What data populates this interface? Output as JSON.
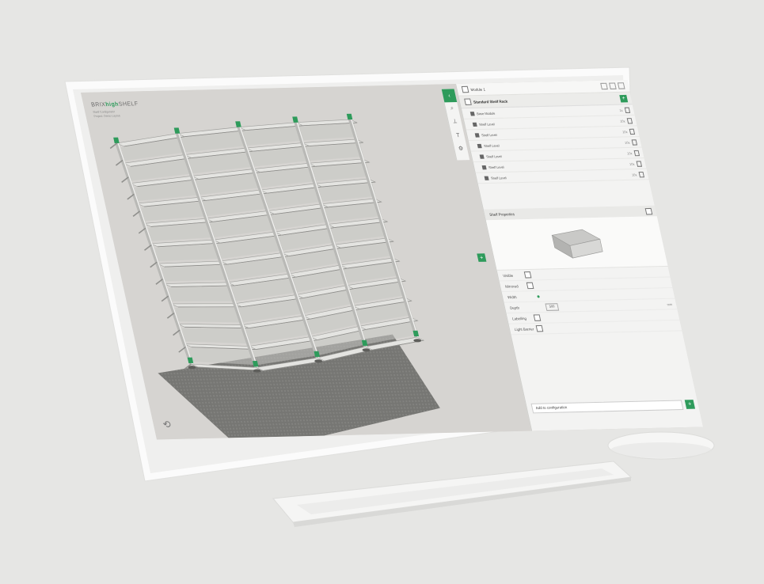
{
  "brand": {
    "prefix": "BRIX",
    "highlight": "high",
    "suffix": "SHELF",
    "subtitle_line1": "Shelf Configurator",
    "subtitle_line2": "Project: Demo Layout"
  },
  "toolbar": {
    "select_icon": "chevron-left-icon",
    "zoom_icon": "search-icon",
    "measure_icon": "ruler-icon",
    "text_icon": "text-icon",
    "settings_icon": "gear-icon"
  },
  "panel": {
    "header": {
      "title": "Module 1",
      "icons": [
        "copy-icon",
        "trash-icon",
        "expand-icon"
      ]
    },
    "layer_title": "Standard Shelf Rack",
    "rows": [
      {
        "label": "Base Module",
        "value": "1x"
      },
      {
        "label": "Shelf Level",
        "value": "10x"
      },
      {
        "label": "Shelf Level",
        "value": "10x"
      },
      {
        "label": "Shelf Level",
        "value": "10x"
      },
      {
        "label": "Shelf Level",
        "value": "10x"
      },
      {
        "label": "Shelf Level",
        "value": "10x"
      },
      {
        "label": "Shelf Level",
        "value": "10x"
      }
    ],
    "properties_title": "Shelf Properties",
    "fields": [
      {
        "label": "Visible",
        "type": "check"
      },
      {
        "label": "Mirrored",
        "type": "check"
      },
      {
        "label": "Width",
        "type": "dot"
      },
      {
        "label": "Depth",
        "type": "num",
        "value": "500",
        "unit": "mm"
      },
      {
        "label": "Labelling",
        "type": "check"
      },
      {
        "label": "Light Barrier",
        "type": "check"
      }
    ],
    "footer_placeholder": "Add to configuration"
  },
  "colors": {
    "accent": "#2e9b5b",
    "panel": "#f3f3f2",
    "viewport": "#d6d4d1"
  }
}
